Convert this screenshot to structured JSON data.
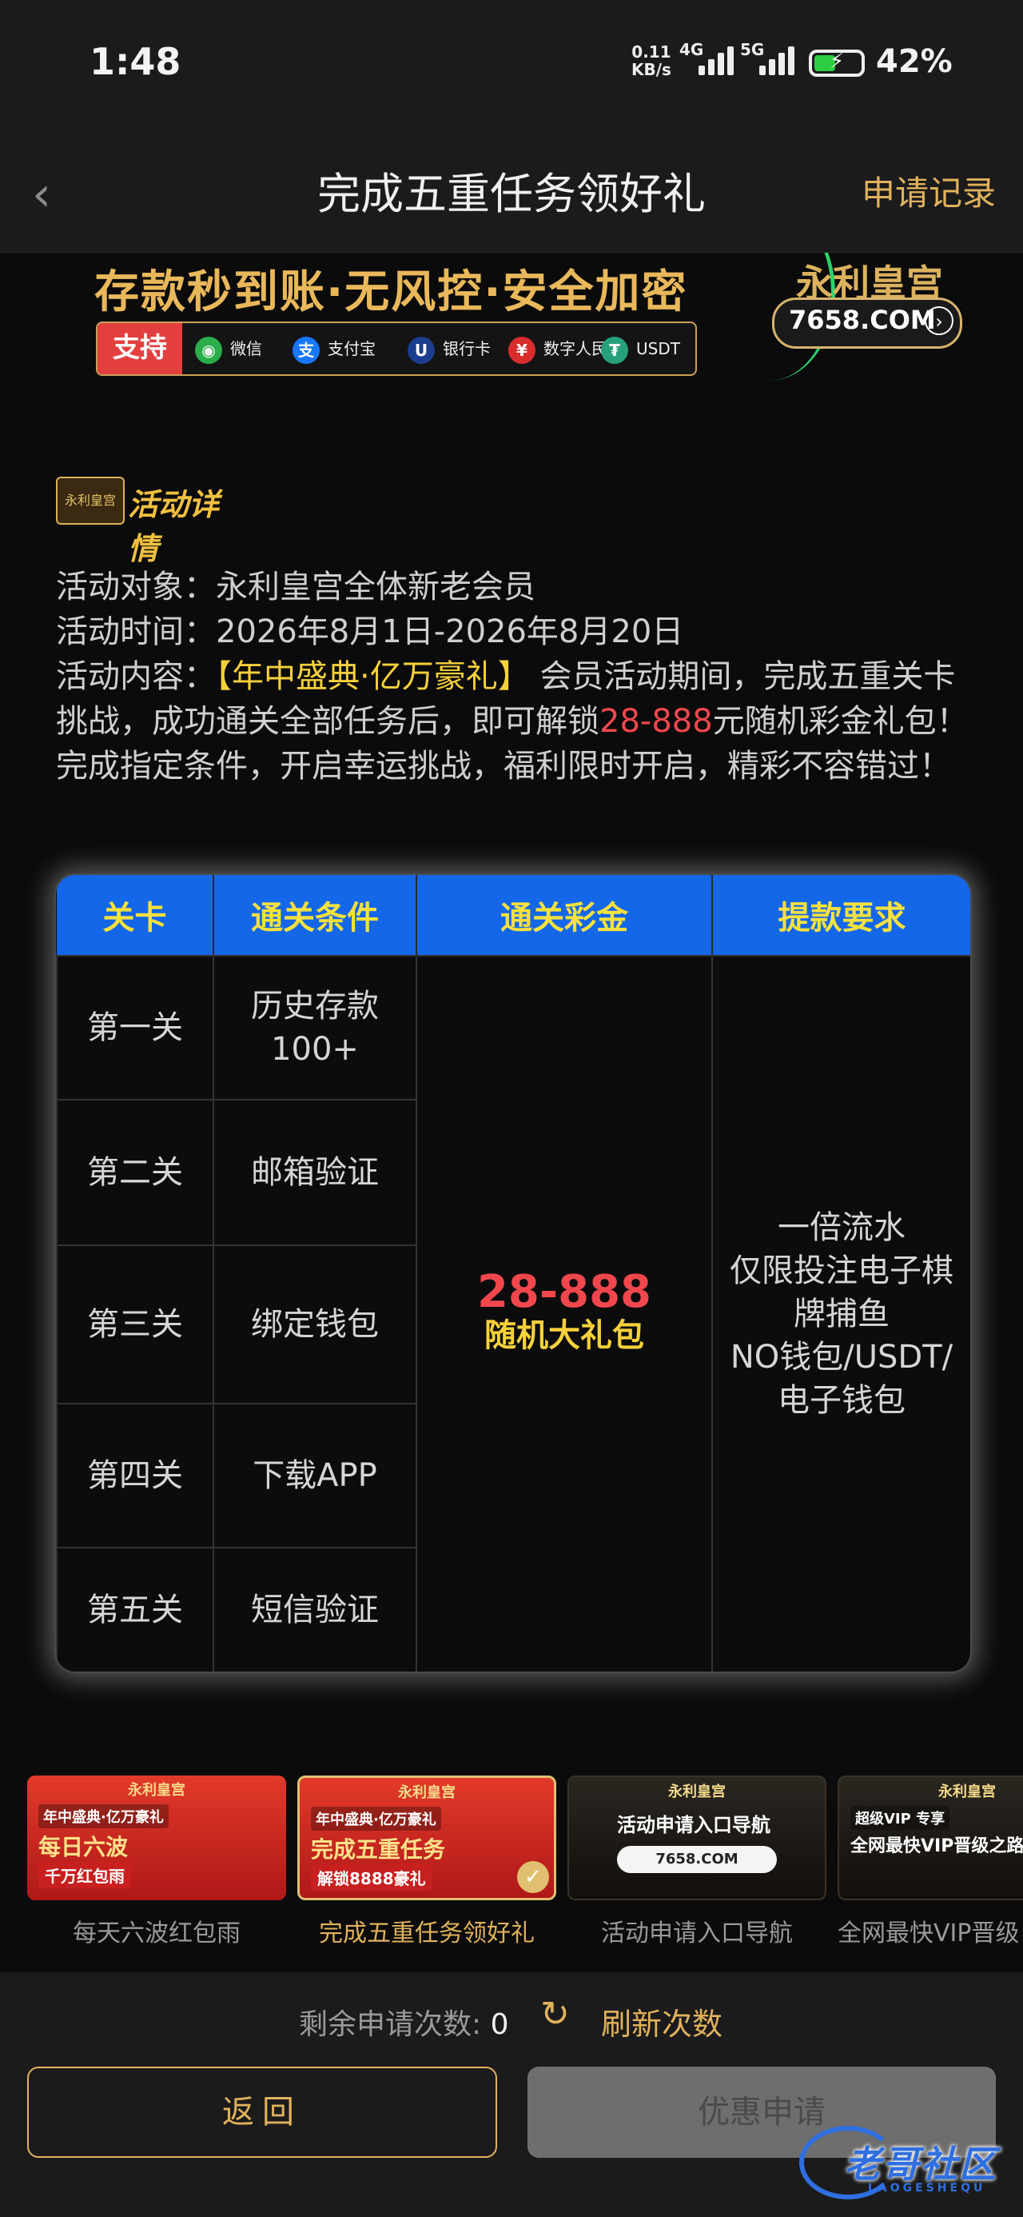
{
  "status_bar": {
    "time": "1:48",
    "net_speed": "0.11",
    "net_unit": "KB/s",
    "sig1": "4G",
    "sig2": "5G",
    "battery": "42%"
  },
  "header": {
    "title": "完成五重任务领好礼",
    "record_link": "申请记录"
  },
  "banner": {
    "slogan": "存款秒到账·无风控·安全加密",
    "support_label": "支持",
    "payments": [
      {
        "label": "微信",
        "icon": "wechat-icon",
        "color": "#2bae4a"
      },
      {
        "label": "支付宝",
        "icon": "alipay-icon",
        "color": "#1677ff"
      },
      {
        "label": "银行卡",
        "icon": "unionpay-icon",
        "color": "#1c3e8f"
      },
      {
        "label": "数字人民币",
        "icon": "ecny-icon",
        "color": "#d92d2d"
      },
      {
        "label": "USDT",
        "icon": "tether-icon",
        "color": "#26a17b"
      }
    ],
    "brand_name": "永利皇宫",
    "brand_domain": "7658.COM"
  },
  "detail": {
    "section_title": "活动详情",
    "logo_text": "永利皇宫",
    "target_label": "活动对象：",
    "target_value": "永利皇宫全体新老会员",
    "time_label": "活动时间：",
    "time_value": "2026年8月1日-2026年8月20日",
    "content_label": "活动内容：",
    "content_highlight": "【年中盛典·亿万豪礼】",
    "content_part1": " 会员活动期间，完成五重关卡挑战，成功通关全部任务后，即可解锁",
    "content_amount": "28-888",
    "content_part2": "元随机彩金礼包！完成指定条件，开启幸运挑战，福利限时开启，精彩不容错过！"
  },
  "table": {
    "headers": [
      "关卡",
      "通关条件",
      "通关彩金",
      "提款要求"
    ],
    "rows": [
      {
        "level": "第一关",
        "condition": "历史存款100+"
      },
      {
        "level": "第二关",
        "condition": "邮箱验证"
      },
      {
        "level": "第三关",
        "condition": "绑定钱包"
      },
      {
        "level": "第四关",
        "condition": "下载APP"
      },
      {
        "level": "第五关",
        "condition": "短信验证"
      }
    ],
    "prize_amount": "28-888",
    "prize_desc": "随机大礼包",
    "requirements": [
      "一倍流水",
      "仅限投注电子棋",
      "牌捕鱼",
      "NO钱包/USDT/",
      "电子钱包"
    ]
  },
  "carousel": [
    {
      "label": "每天六波红包雨",
      "brand": "永利皇宫",
      "l1": "年中盛典·亿万豪礼",
      "l2": "每日六波",
      "l3": "千万红包雨",
      "active": false
    },
    {
      "label": "完成五重任务领好礼",
      "brand": "永利皇宫",
      "l1": "年中盛典·亿万豪礼",
      "l2": "完成五重任务",
      "l3": "解锁8888豪礼",
      "active": true
    },
    {
      "label": "活动申请入口导航",
      "brand": "永利皇宫",
      "l1": "",
      "l2": "活动申请入口导航",
      "l3": "7658.COM",
      "active": false
    },
    {
      "label": "全网最快VIP晋级",
      "brand": "永利皇宫",
      "l1": "超级VIP 专享",
      "l2": "全网最快VIP晋级之路",
      "l3": "",
      "active": false
    }
  ],
  "bottom": {
    "remain_label": "剩余申请次数:",
    "remain_count": "0",
    "refresh_label": "刷新次数",
    "back_button": "返回",
    "apply_button": "优惠申请"
  },
  "watermark": {
    "text": "老哥社区",
    "sub": "LAOGESHEQU"
  },
  "colors": {
    "accent_gold": "#e1b25c",
    "table_header": "#1467e8",
    "highlight_red": "#f0474d",
    "highlight_yellow": "#f7d13b"
  }
}
